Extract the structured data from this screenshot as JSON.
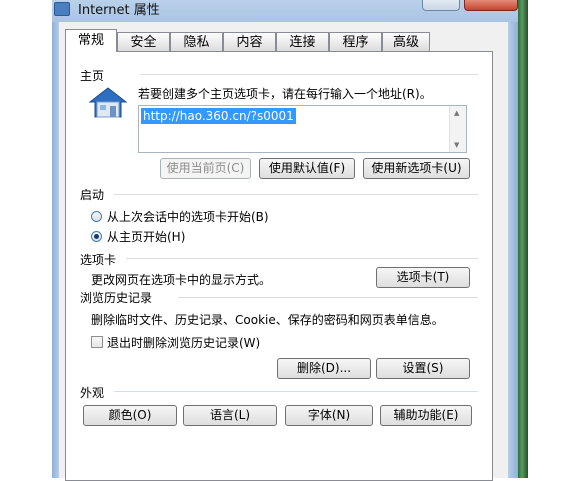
{
  "window": {
    "title": "Internet 属性"
  },
  "tabs": [
    "常规",
    "安全",
    "隐私",
    "内容",
    "连接",
    "程序",
    "高级"
  ],
  "homepage": {
    "section_title": "主页",
    "instruction": "若要创建多个主页选项卡，请在每行输入一个地址(R)。",
    "url": "http://hao.360.cn/?s0001",
    "btn_use_current": "使用当前页(C)",
    "btn_use_default": "使用默认值(F)",
    "btn_use_new_tab": "使用新选项卡(U)"
  },
  "startup": {
    "section_title": "启动",
    "option_last_session": "从上次会话中的选项卡开始(B)",
    "option_home_page": "从主页开始(H)",
    "selected": "option_home_page"
  },
  "tabs_section": {
    "section_title": "选项卡",
    "description": "更改网页在选项卡中的显示方式。",
    "btn_tabs": "选项卡(T)"
  },
  "history": {
    "section_title": "浏览历史记录",
    "description": "删除临时文件、历史记录、Cookie、保存的密码和网页表单信息。",
    "checkbox_delete_on_exit": "退出时删除浏览历史记录(W)",
    "checkbox_checked": false,
    "btn_delete": "删除(D)...",
    "btn_settings": "设置(S)"
  },
  "appearance": {
    "section_title": "外观",
    "btn_colors": "颜色(O)",
    "btn_languages": "语言(L)",
    "btn_fonts": "字体(N)",
    "btn_accessibility": "辅助功能(E)"
  }
}
